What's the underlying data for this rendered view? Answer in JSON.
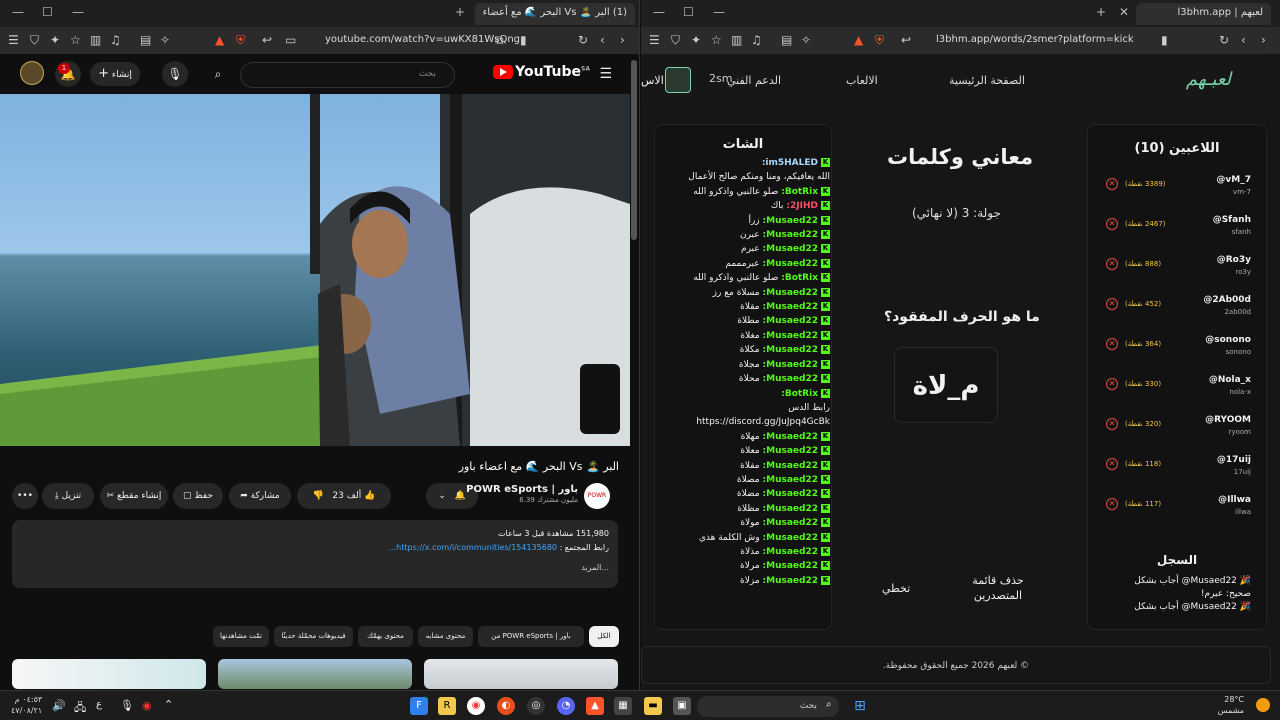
{
  "left_browser": {
    "tab_title": "(1) البر 🏝️ Vs البحر 🌊 مع أعضاء",
    "url": "youtube.com/watch?v=uwKX81WsQng"
  },
  "youtube": {
    "logo": "YouTube",
    "region": "SA",
    "search_placeholder": "بحث",
    "create_label": "إنشاء",
    "notification_count": "1",
    "video_title": "البر 🏝️ Vs البحر 🌊 مع اعضاء باور",
    "channel_name": "POWR eSports | باور",
    "subscribers": "6.39 مليون مشترك",
    "likes": "23 ألف",
    "share_label": "مشاركة",
    "save_label": "حفظ",
    "clip_label": "إنشاء مقطع",
    "download_label": "تنزيل",
    "views_line": "151,980 مشاهدة قبل 3 ساعات",
    "community_label": "رابط المجتمع :",
    "community_link": "https://x.com/i/communities/154135680...",
    "more_label": "...المزيد",
    "chips": [
      "الكل",
      "من POWR eSports | باور",
      "محتوى مشابه",
      "محتوى يهمّك",
      "فيديوهات محمّلة حديثًا",
      "تمّت مشاهدتها"
    ]
  },
  "right_browser": {
    "tab_title": "لعبهم | l3bhm.app",
    "url": "l3bhm.app/words/2smer?platform=kick"
  },
  "site": {
    "logo": "لعبـهم",
    "nav": [
      "الصفحة الرئيسية",
      "الالعاب",
      "الدعم الفني",
      "الاس"
    ],
    "user_handle": "2sm",
    "chat_title": "الشات",
    "chat": [
      {
        "user": "im5HALED:",
        "msg": "",
        "color": "blue"
      },
      {
        "user": "",
        "msg": "الله يعافيكم، ومنا ومنكم صالح الأعمال",
        "color": ""
      },
      {
        "user": "BotRix:",
        "msg": "صلو عالنبي واذكرو الله",
        "color": "green"
      },
      {
        "user": "2JIHD:",
        "msg": "باك",
        "color": "red"
      },
      {
        "user": "Musaed22:",
        "msg": "زرأ",
        "color": "green"
      },
      {
        "user": "Musaed22:",
        "msg": "عبرن",
        "color": "green"
      },
      {
        "user": "Musaed22:",
        "msg": "عبرم",
        "color": "green"
      },
      {
        "user": "Musaed22:",
        "msg": "عبرمممم",
        "color": "green"
      },
      {
        "user": "BotRix:",
        "msg": "صلو عالنبي واذكرو الله",
        "color": "green"
      },
      {
        "user": "Musaed22:",
        "msg": "مسلاة مع رز",
        "color": "green"
      },
      {
        "user": "Musaed22:",
        "msg": "مقلاة",
        "color": "green"
      },
      {
        "user": "Musaed22:",
        "msg": "مطلاة",
        "color": "green"
      },
      {
        "user": "Musaed22:",
        "msg": "مغلاة",
        "color": "green"
      },
      {
        "user": "Musaed22:",
        "msg": "مكلاة",
        "color": "green"
      },
      {
        "user": "Musaed22:",
        "msg": "مجلاة",
        "color": "green"
      },
      {
        "user": "Musaed22:",
        "msg": "محلاة",
        "color": "green"
      },
      {
        "user": "BotRix:",
        "msg": "",
        "color": "green"
      },
      {
        "user": "",
        "msg": "رابط الدس",
        "color": ""
      },
      {
        "user": "",
        "msg": "https://discord.gg/JuJpq4GcBk",
        "color": ""
      },
      {
        "user": "Musaed22:",
        "msg": "مهلاة",
        "color": "green"
      },
      {
        "user": "Musaed22:",
        "msg": "معلاة",
        "color": "green"
      },
      {
        "user": "Musaed22:",
        "msg": "مفلاة",
        "color": "green"
      },
      {
        "user": "Musaed22:",
        "msg": "مصلاة",
        "color": "green"
      },
      {
        "user": "Musaed22:",
        "msg": "مضلاة",
        "color": "green"
      },
      {
        "user": "Musaed22:",
        "msg": "مظلاة",
        "color": "green"
      },
      {
        "user": "Musaed22:",
        "msg": "مولاة",
        "color": "green"
      },
      {
        "user": "Musaed22:",
        "msg": "وش الكلمة هذي",
        "color": "green"
      },
      {
        "user": "Musaed22:",
        "msg": "مذلاة",
        "color": "green"
      },
      {
        "user": "Musaed22:",
        "msg": "مرلاة",
        "color": "green"
      },
      {
        "user": "Musaed22:",
        "msg": "مزلاة",
        "color": "green"
      }
    ],
    "game_title": "معاني وكلمات",
    "round": "جولة: 3 (لا نهائي)",
    "question": "ما هو الحرف المفقود؟",
    "word": "م_لاة",
    "delete_leaders": "حذف قائمة المتصدرين",
    "skip": "تخطي",
    "players_title": "اللاعبين (10)",
    "players": [
      {
        "name": "@vM_7",
        "sub": "vm-7",
        "pts": "(3389 نقطة)"
      },
      {
        "name": "@Sfanh",
        "sub": "sfanh",
        "pts": "(2467 نقطة)"
      },
      {
        "name": "@Ro3y",
        "sub": "ro3y",
        "pts": "(888 نقطة)"
      },
      {
        "name": "@2Ab00d",
        "sub": "2ab00d",
        "pts": "(452 نقطة)"
      },
      {
        "name": "@sonono",
        "sub": "sonono",
        "pts": "(364 نقطة)"
      },
      {
        "name": "@Nola_x",
        "sub": "nola-x",
        "pts": "(330 نقطة)"
      },
      {
        "name": "@RYOOM",
        "sub": "ryoom",
        "pts": "(320 نقطة)"
      },
      {
        "name": "@17uij",
        "sub": "17uij",
        "pts": "(118 نقطة)"
      },
      {
        "name": "@Illwa",
        "sub": "illwa",
        "pts": "(117 نقطة)"
      }
    ],
    "log_title": "السجل",
    "log": [
      "🎉 Musaed22@ أجاب بشكل",
      "صحيح: عبرم!",
      "🎉 Musaed22@ أجاب بشكل"
    ],
    "footer": "© لعبهم 2026 جميع الحقوق محفوظة."
  },
  "taskbar": {
    "search_placeholder": "بحث",
    "temp": "28°C",
    "weather": "مشمس",
    "time": "٠٤:٥٣ م",
    "date": "٤٧/٠٨/٢١",
    "lang": "ع"
  }
}
